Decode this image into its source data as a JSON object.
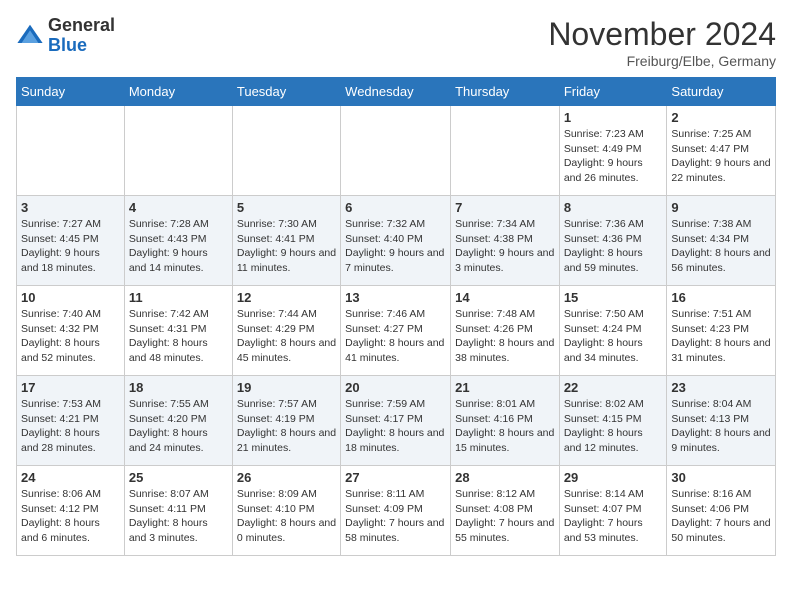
{
  "header": {
    "logo_general": "General",
    "logo_blue": "Blue",
    "month_title": "November 2024",
    "location": "Freiburg/Elbe, Germany"
  },
  "weekdays": [
    "Sunday",
    "Monday",
    "Tuesday",
    "Wednesday",
    "Thursday",
    "Friday",
    "Saturday"
  ],
  "rows": [
    [
      {
        "day": "",
        "info": ""
      },
      {
        "day": "",
        "info": ""
      },
      {
        "day": "",
        "info": ""
      },
      {
        "day": "",
        "info": ""
      },
      {
        "day": "",
        "info": ""
      },
      {
        "day": "1",
        "info": "Sunrise: 7:23 AM\nSunset: 4:49 PM\nDaylight: 9 hours and 26 minutes."
      },
      {
        "day": "2",
        "info": "Sunrise: 7:25 AM\nSunset: 4:47 PM\nDaylight: 9 hours and 22 minutes."
      }
    ],
    [
      {
        "day": "3",
        "info": "Sunrise: 7:27 AM\nSunset: 4:45 PM\nDaylight: 9 hours and 18 minutes."
      },
      {
        "day": "4",
        "info": "Sunrise: 7:28 AM\nSunset: 4:43 PM\nDaylight: 9 hours and 14 minutes."
      },
      {
        "day": "5",
        "info": "Sunrise: 7:30 AM\nSunset: 4:41 PM\nDaylight: 9 hours and 11 minutes."
      },
      {
        "day": "6",
        "info": "Sunrise: 7:32 AM\nSunset: 4:40 PM\nDaylight: 9 hours and 7 minutes."
      },
      {
        "day": "7",
        "info": "Sunrise: 7:34 AM\nSunset: 4:38 PM\nDaylight: 9 hours and 3 minutes."
      },
      {
        "day": "8",
        "info": "Sunrise: 7:36 AM\nSunset: 4:36 PM\nDaylight: 8 hours and 59 minutes."
      },
      {
        "day": "9",
        "info": "Sunrise: 7:38 AM\nSunset: 4:34 PM\nDaylight: 8 hours and 56 minutes."
      }
    ],
    [
      {
        "day": "10",
        "info": "Sunrise: 7:40 AM\nSunset: 4:32 PM\nDaylight: 8 hours and 52 minutes."
      },
      {
        "day": "11",
        "info": "Sunrise: 7:42 AM\nSunset: 4:31 PM\nDaylight: 8 hours and 48 minutes."
      },
      {
        "day": "12",
        "info": "Sunrise: 7:44 AM\nSunset: 4:29 PM\nDaylight: 8 hours and 45 minutes."
      },
      {
        "day": "13",
        "info": "Sunrise: 7:46 AM\nSunset: 4:27 PM\nDaylight: 8 hours and 41 minutes."
      },
      {
        "day": "14",
        "info": "Sunrise: 7:48 AM\nSunset: 4:26 PM\nDaylight: 8 hours and 38 minutes."
      },
      {
        "day": "15",
        "info": "Sunrise: 7:50 AM\nSunset: 4:24 PM\nDaylight: 8 hours and 34 minutes."
      },
      {
        "day": "16",
        "info": "Sunrise: 7:51 AM\nSunset: 4:23 PM\nDaylight: 8 hours and 31 minutes."
      }
    ],
    [
      {
        "day": "17",
        "info": "Sunrise: 7:53 AM\nSunset: 4:21 PM\nDaylight: 8 hours and 28 minutes."
      },
      {
        "day": "18",
        "info": "Sunrise: 7:55 AM\nSunset: 4:20 PM\nDaylight: 8 hours and 24 minutes."
      },
      {
        "day": "19",
        "info": "Sunrise: 7:57 AM\nSunset: 4:19 PM\nDaylight: 8 hours and 21 minutes."
      },
      {
        "day": "20",
        "info": "Sunrise: 7:59 AM\nSunset: 4:17 PM\nDaylight: 8 hours and 18 minutes."
      },
      {
        "day": "21",
        "info": "Sunrise: 8:01 AM\nSunset: 4:16 PM\nDaylight: 8 hours and 15 minutes."
      },
      {
        "day": "22",
        "info": "Sunrise: 8:02 AM\nSunset: 4:15 PM\nDaylight: 8 hours and 12 minutes."
      },
      {
        "day": "23",
        "info": "Sunrise: 8:04 AM\nSunset: 4:13 PM\nDaylight: 8 hours and 9 minutes."
      }
    ],
    [
      {
        "day": "24",
        "info": "Sunrise: 8:06 AM\nSunset: 4:12 PM\nDaylight: 8 hours and 6 minutes."
      },
      {
        "day": "25",
        "info": "Sunrise: 8:07 AM\nSunset: 4:11 PM\nDaylight: 8 hours and 3 minutes."
      },
      {
        "day": "26",
        "info": "Sunrise: 8:09 AM\nSunset: 4:10 PM\nDaylight: 8 hours and 0 minutes."
      },
      {
        "day": "27",
        "info": "Sunrise: 8:11 AM\nSunset: 4:09 PM\nDaylight: 7 hours and 58 minutes."
      },
      {
        "day": "28",
        "info": "Sunrise: 8:12 AM\nSunset: 4:08 PM\nDaylight: 7 hours and 55 minutes."
      },
      {
        "day": "29",
        "info": "Sunrise: 8:14 AM\nSunset: 4:07 PM\nDaylight: 7 hours and 53 minutes."
      },
      {
        "day": "30",
        "info": "Sunrise: 8:16 AM\nSunset: 4:06 PM\nDaylight: 7 hours and 50 minutes."
      }
    ]
  ]
}
